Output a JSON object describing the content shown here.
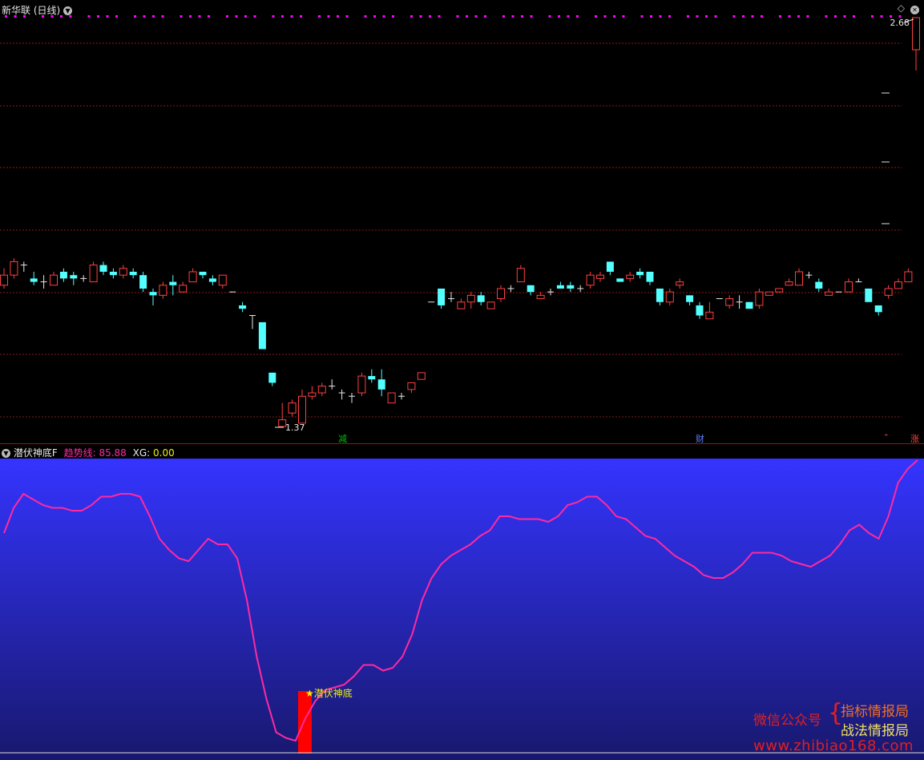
{
  "main_panel": {
    "title": "新华联 (日线)",
    "collapse_icon": "chevron-down-icon",
    "corner_icon": "diamond-icon",
    "high_label": "2.68",
    "low_label": "1.37",
    "event_markers": [
      {
        "text": "减",
        "color": "#00c000"
      },
      {
        "text": "财",
        "color": "#6080ff"
      },
      {
        "text": "涨",
        "color": "#ff4040"
      }
    ]
  },
  "indicator_panel": {
    "title": "潜伏神底F",
    "trend_label": "趋势线:",
    "trend_value": "85.88",
    "xg_label": "XG:",
    "xg_value": "0.00",
    "signal_label": "★潜伏神底"
  },
  "watermark": {
    "wechat": "微信公众号",
    "brace": "{",
    "line1": "指标情报局",
    "line2": "战法情报局",
    "url": "www.zhibiao168.com"
  },
  "colors": {
    "up": "#ff4040",
    "down": "#54ffff",
    "grid": "#8a1a1a",
    "trend": "#ff2aa0",
    "bg_top": "#3434ff",
    "bg_bottom": "#18186e",
    "signal_bar": "#ff0000",
    "dots": "#ff00ff"
  },
  "chart_data": {
    "type": "candlestick",
    "annotations": {
      "high": 2.68,
      "low": 1.37
    },
    "candles": [
      [
        1.79,
        1.82,
        1.78,
        1.84
      ],
      [
        1.82,
        1.86,
        1.81,
        1.87
      ],
      [
        1.85,
        1.85,
        1.83,
        1.86
      ],
      [
        1.81,
        1.8,
        1.79,
        1.83
      ],
      [
        1.8,
        1.8,
        1.78,
        1.82
      ],
      [
        1.79,
        1.82,
        1.79,
        1.83
      ],
      [
        1.83,
        1.81,
        1.8,
        1.84
      ],
      [
        1.82,
        1.81,
        1.79,
        1.83
      ],
      [
        1.81,
        1.81,
        1.8,
        1.82
      ],
      [
        1.8,
        1.85,
        1.8,
        1.86
      ],
      [
        1.85,
        1.83,
        1.82,
        1.86
      ],
      [
        1.83,
        1.82,
        1.81,
        1.84
      ],
      [
        1.82,
        1.84,
        1.81,
        1.85
      ],
      [
        1.83,
        1.82,
        1.81,
        1.84
      ],
      [
        1.82,
        1.78,
        1.77,
        1.83
      ],
      [
        1.77,
        1.76,
        1.73,
        1.78
      ],
      [
        1.76,
        1.79,
        1.75,
        1.8
      ],
      [
        1.8,
        1.79,
        1.76,
        1.82
      ],
      [
        1.77,
        1.79,
        1.77,
        1.8
      ],
      [
        1.8,
        1.83,
        1.8,
        1.84
      ],
      [
        1.83,
        1.82,
        1.81,
        1.83
      ],
      [
        1.81,
        1.8,
        1.79,
        1.82
      ],
      [
        1.79,
        1.82,
        1.78,
        1.82
      ],
      [
        1.77,
        1.77,
        1.77,
        1.77
      ],
      [
        1.73,
        1.72,
        1.71,
        1.74
      ],
      [
        1.7,
        1.7,
        1.66,
        1.7
      ],
      [
        1.68,
        1.6,
        1.6,
        1.68
      ],
      [
        1.53,
        1.5,
        1.49,
        1.53
      ],
      [
        1.37,
        1.39,
        1.37,
        1.44
      ],
      [
        1.41,
        1.44,
        1.4,
        1.45
      ],
      [
        1.38,
        1.46,
        1.38,
        1.48
      ],
      [
        1.46,
        1.47,
        1.45,
        1.49
      ],
      [
        1.47,
        1.49,
        1.46,
        1.5
      ],
      [
        1.49,
        1.49,
        1.48,
        1.51
      ],
      [
        1.47,
        1.47,
        1.45,
        1.48
      ],
      [
        1.46,
        1.46,
        1.44,
        1.47
      ],
      [
        1.47,
        1.52,
        1.46,
        1.53
      ],
      [
        1.52,
        1.51,
        1.5,
        1.54
      ],
      [
        1.51,
        1.48,
        1.46,
        1.54
      ],
      [
        1.44,
        1.47,
        1.44,
        1.47
      ],
      [
        1.46,
        1.46,
        1.45,
        1.47
      ],
      [
        1.48,
        1.5,
        1.47,
        1.5
      ],
      [
        1.51,
        1.53,
        1.51,
        1.53
      ],
      [
        1.74,
        1.74,
        1.74,
        1.74
      ],
      [
        1.78,
        1.73,
        1.72,
        1.78
      ],
      [
        1.75,
        1.75,
        1.74,
        1.77
      ],
      [
        1.72,
        1.74,
        1.72,
        1.75
      ],
      [
        1.74,
        1.76,
        1.72,
        1.77
      ],
      [
        1.76,
        1.74,
        1.73,
        1.77
      ],
      [
        1.72,
        1.74,
        1.72,
        1.74
      ],
      [
        1.75,
        1.78,
        1.74,
        1.79
      ],
      [
        1.78,
        1.78,
        1.77,
        1.79
      ],
      [
        1.8,
        1.84,
        1.8,
        1.85
      ],
      [
        1.79,
        1.77,
        1.76,
        1.79
      ],
      [
        1.75,
        1.76,
        1.75,
        1.77
      ],
      [
        1.77,
        1.77,
        1.76,
        1.78
      ],
      [
        1.79,
        1.78,
        1.78,
        1.8
      ],
      [
        1.79,
        1.78,
        1.77,
        1.8
      ],
      [
        1.78,
        1.78,
        1.77,
        1.79
      ],
      [
        1.79,
        1.82,
        1.78,
        1.83
      ],
      [
        1.81,
        1.82,
        1.8,
        1.83
      ],
      [
        1.86,
        1.83,
        1.82,
        1.86
      ],
      [
        1.81,
        1.8,
        1.8,
        1.81
      ],
      [
        1.81,
        1.82,
        1.8,
        1.83
      ],
      [
        1.83,
        1.82,
        1.81,
        1.84
      ],
      [
        1.83,
        1.8,
        1.79,
        1.83
      ],
      [
        1.78,
        1.74,
        1.73,
        1.78
      ],
      [
        1.74,
        1.77,
        1.73,
        1.78
      ],
      [
        1.79,
        1.8,
        1.78,
        1.81
      ],
      [
        1.76,
        1.74,
        1.73,
        1.76
      ],
      [
        1.73,
        1.7,
        1.69,
        1.74
      ],
      [
        1.69,
        1.71,
        1.69,
        1.74
      ],
      [
        1.75,
        1.75,
        1.75,
        1.75
      ],
      [
        1.73,
        1.75,
        1.72,
        1.76
      ],
      [
        1.74,
        1.74,
        1.72,
        1.76
      ],
      [
        1.74,
        1.72,
        1.72,
        1.74
      ],
      [
        1.73,
        1.77,
        1.72,
        1.78
      ],
      [
        1.76,
        1.77,
        1.76,
        1.77
      ],
      [
        1.77,
        1.78,
        1.77,
        1.78
      ],
      [
        1.79,
        1.8,
        1.79,
        1.81
      ],
      [
        1.79,
        1.83,
        1.79,
        1.84
      ],
      [
        1.82,
        1.82,
        1.81,
        1.83
      ],
      [
        1.8,
        1.78,
        1.77,
        1.81
      ],
      [
        1.76,
        1.77,
        1.76,
        1.78
      ],
      [
        1.77,
        1.77,
        1.77,
        1.77
      ],
      [
        1.77,
        1.8,
        1.77,
        1.81
      ],
      [
        1.8,
        1.8,
        1.8,
        1.81
      ],
      [
        1.78,
        1.74,
        1.74,
        1.78
      ],
      [
        1.73,
        1.71,
        1.7,
        1.73
      ],
      [
        1.76,
        1.78,
        1.75,
        1.79
      ],
      [
        1.78,
        1.8,
        1.78,
        1.81
      ],
      [
        1.8,
        1.83,
        1.8,
        1.84
      ],
      [
        2.3,
        2.68,
        2.3,
        2.68
      ]
    ],
    "indicator": {
      "name": "趋势线",
      "last_value": 85.88,
      "values": [
        74,
        83,
        88,
        86,
        84,
        83,
        83,
        82,
        82,
        84,
        87,
        87,
        88,
        88,
        87,
        80,
        72,
        68,
        65,
        64,
        68,
        72,
        70,
        70,
        65,
        50,
        30,
        15,
        3,
        1,
        0,
        8,
        14,
        18,
        19,
        20,
        23,
        27,
        27,
        25,
        26,
        30,
        38,
        50,
        58,
        63,
        66,
        68,
        70,
        73,
        75,
        80,
        80,
        79,
        79,
        79,
        78,
        80,
        84,
        85,
        87,
        87,
        84,
        80,
        79,
        76,
        73,
        72,
        69,
        66,
        64,
        62,
        59,
        58,
        58,
        60,
        63,
        67,
        67,
        67,
        66,
        64,
        63,
        62,
        64,
        66,
        70,
        75,
        77,
        74,
        72,
        80,
        92,
        97,
        100
      ]
    },
    "signals": [
      {
        "index": 31,
        "label": "★潜伏神底"
      }
    ]
  }
}
